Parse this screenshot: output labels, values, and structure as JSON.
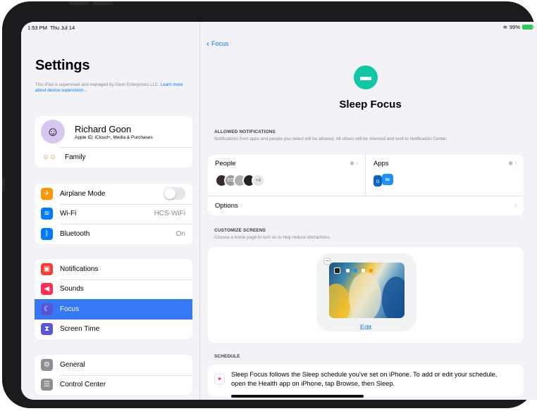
{
  "status_bar": {
    "time": "1:53 PM",
    "date": "Thu Jul 14",
    "battery": "99%"
  },
  "sidebar": {
    "title": "Settings",
    "supervision_text": "This iPad is supervised and managed by Goon Enterprises LLC.",
    "supervision_link": "Learn more about device supervision...",
    "profile": {
      "name": "Richard Goon",
      "subtitle": "Apple ID, iCloud+, Media & Purchases"
    },
    "family_label": "Family",
    "connectivity": [
      {
        "label": "Airplane Mode",
        "icon": "airplane-icon",
        "color": "#ff9500",
        "value": ""
      },
      {
        "label": "Wi-Fi",
        "icon": "wifi-icon",
        "color": "#007aff",
        "value": "HCS-WiFi"
      },
      {
        "label": "Bluetooth",
        "icon": "bluetooth-icon",
        "color": "#007aff",
        "value": "On"
      }
    ],
    "notifications_group": [
      {
        "label": "Notifications",
        "icon": "notifications-icon",
        "color": "#ff3b30"
      },
      {
        "label": "Sounds",
        "icon": "sounds-icon",
        "color": "#ff2d55"
      },
      {
        "label": "Focus",
        "icon": "moon-icon",
        "color": "#5856d6",
        "selected": true
      },
      {
        "label": "Screen Time",
        "icon": "hourglass-icon",
        "color": "#5856d6"
      }
    ],
    "general_group": [
      {
        "label": "General",
        "icon": "gear-icon",
        "color": "#8e8e93"
      },
      {
        "label": "Control Center",
        "icon": "control-center-icon",
        "color": "#8e8e93"
      }
    ]
  },
  "detail": {
    "back_label": "Focus",
    "focus_name": "Sleep Focus",
    "focus_color": "#11c7a5",
    "allowed": {
      "header": "ALLOWED NOTIFICATIONS",
      "subtext": "Notifications from apps and people you select will be allowed. All others will be silenced and sent to Notification Center.",
      "people_label": "People",
      "people_initials": "EG",
      "people_more": "+4",
      "apps_label": "Apps",
      "options_label": "Options"
    },
    "customize": {
      "header": "CUSTOMIZE SCREENS",
      "subtext": "Choose a home page to turn on to help reduce distractions.",
      "edit_label": "Edit"
    },
    "schedule": {
      "header": "SCHEDULE",
      "text": "Sleep Focus follows the Sleep schedule you've set on iPhone. To add or edit your schedule, open the Health app on iPhone, tap Browse, then Sleep."
    }
  }
}
